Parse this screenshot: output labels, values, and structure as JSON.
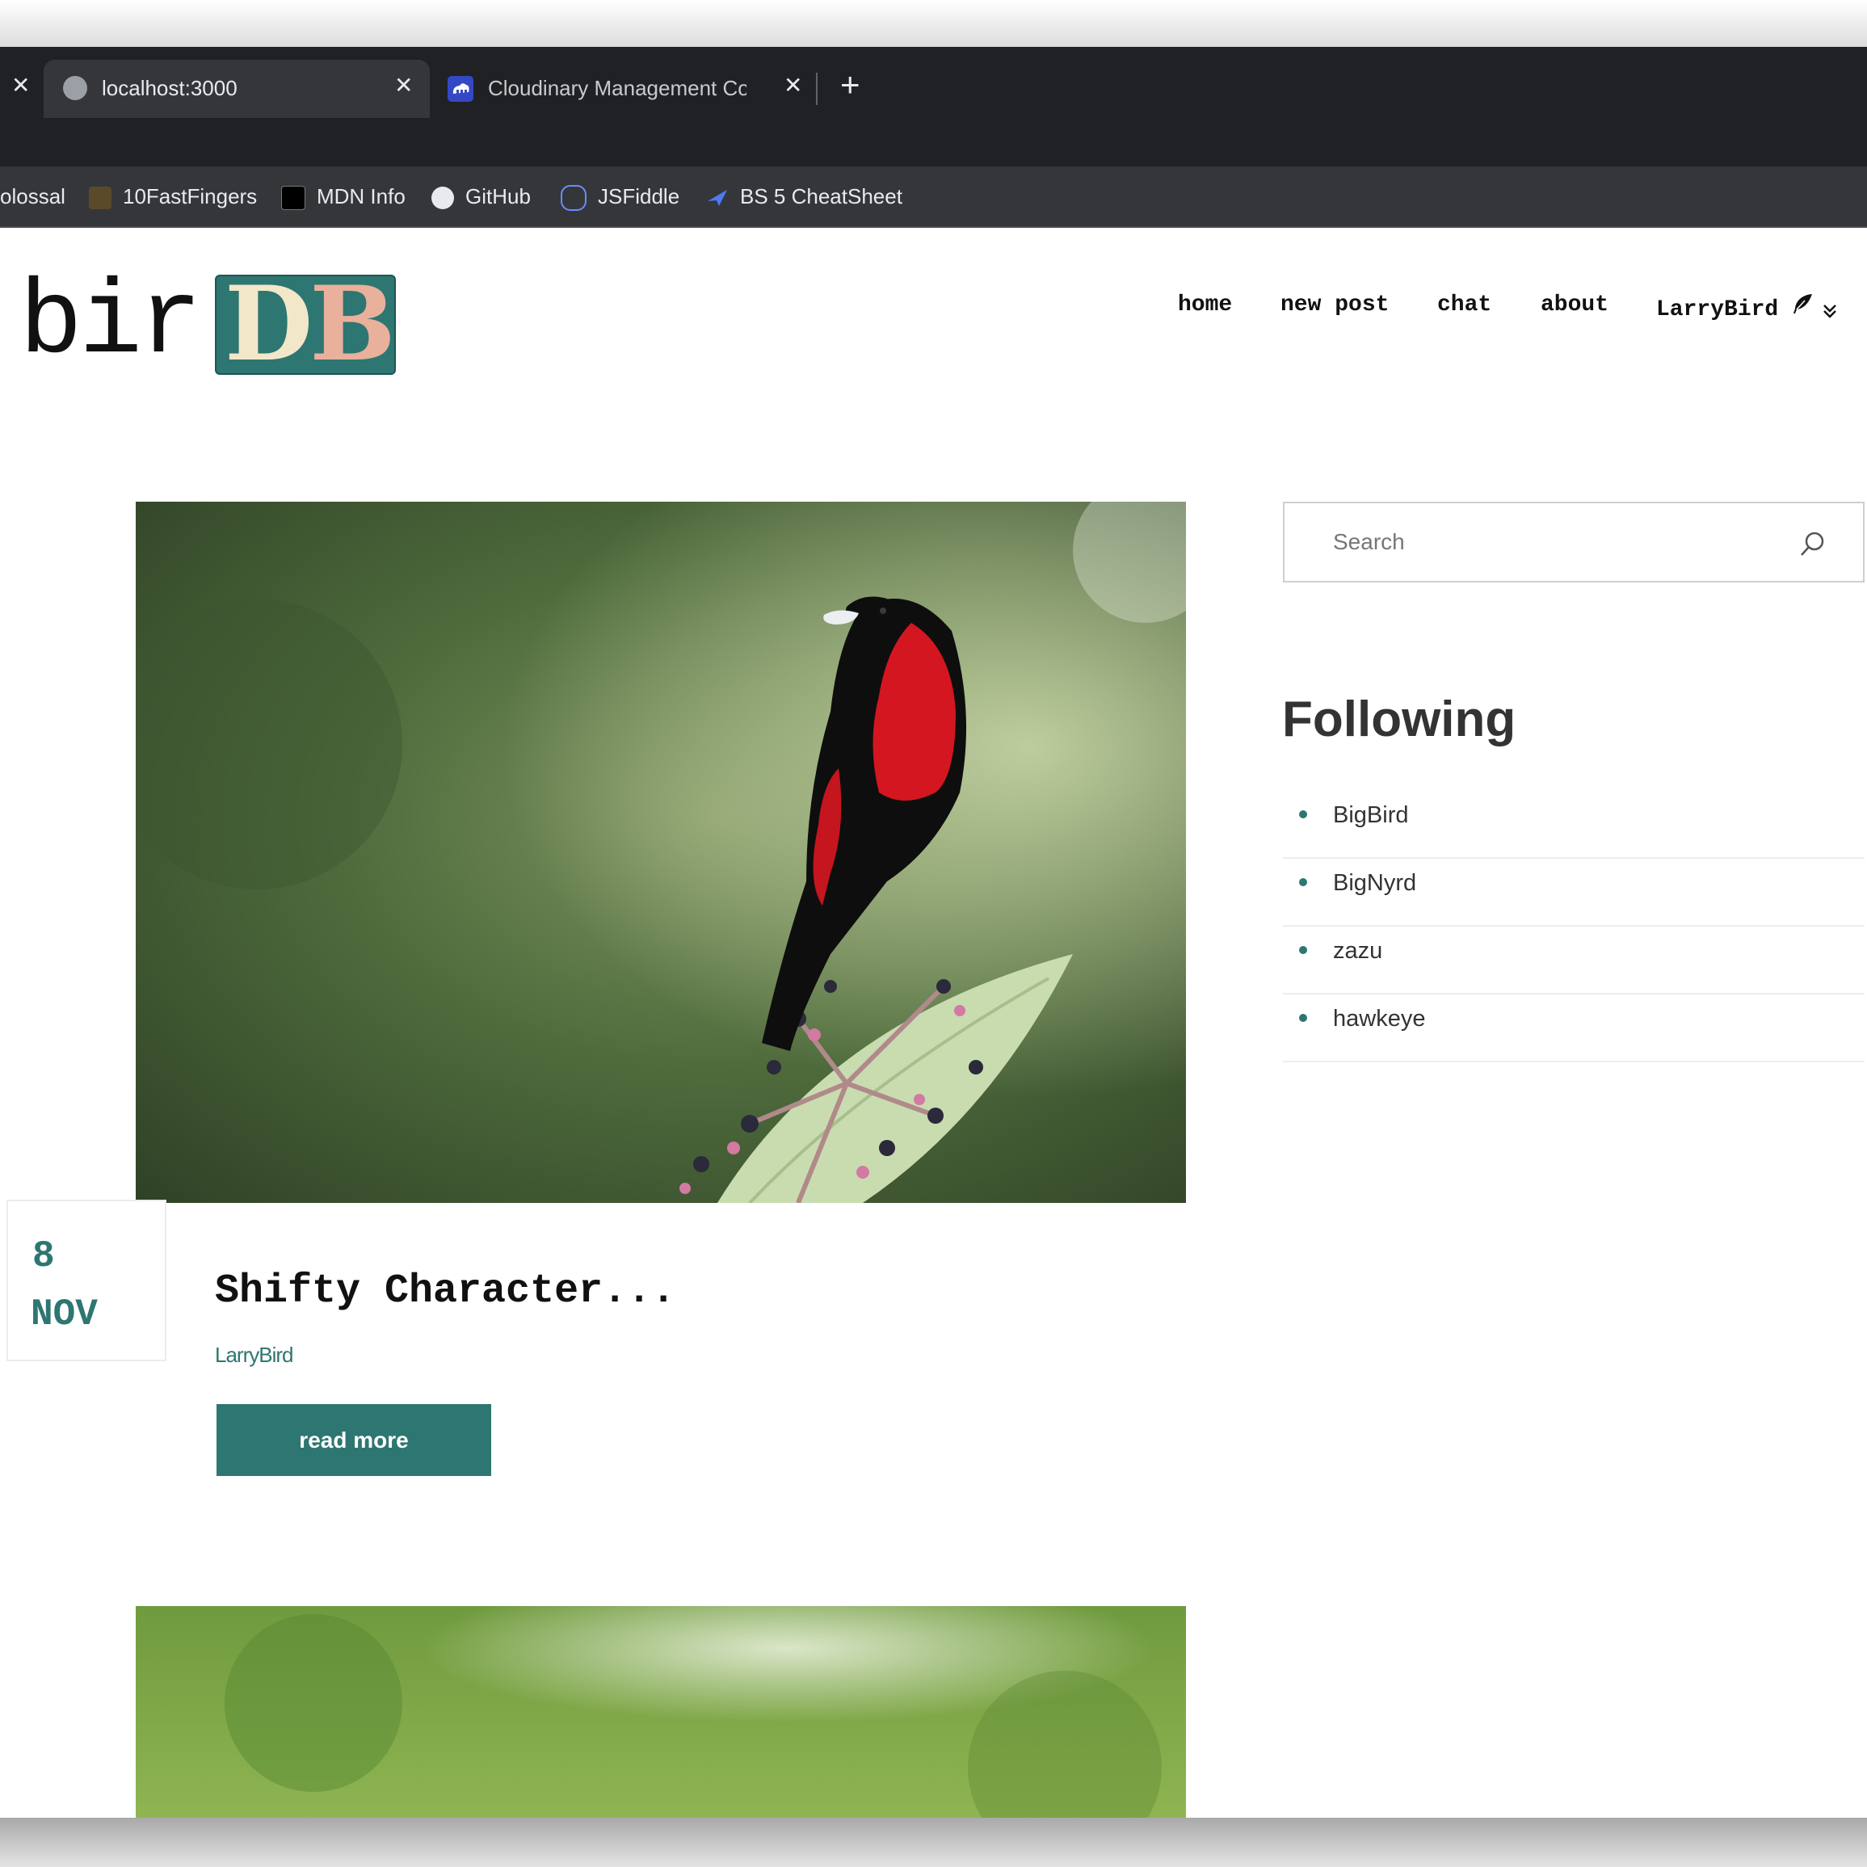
{
  "browser": {
    "tabs": [
      {
        "title": "localhost:3000",
        "active": true
      },
      {
        "title": "Cloudinary Management Console",
        "active": false
      }
    ],
    "new_tab_label": "+",
    "close_glyph": "✕",
    "bookmarks": [
      {
        "label": "olossal",
        "icon": "cut-off-icon"
      },
      {
        "label": "10FastFingers",
        "icon": "10fastfingers-icon"
      },
      {
        "label": "MDN Info",
        "icon": "mdn-icon"
      },
      {
        "label": "GitHub",
        "icon": "github-icon"
      },
      {
        "label": "JSFiddle",
        "icon": "jsfiddle-icon"
      },
      {
        "label": "BS 5 CheatSheet",
        "icon": "bootstrap-icon"
      }
    ]
  },
  "site": {
    "logo": {
      "bir": "bir",
      "d": "D",
      "b": "B"
    },
    "nav": {
      "home": "home",
      "new_post": "new post",
      "chat": "chat",
      "about": "about",
      "user": "LarryBird"
    },
    "accent_color": "#2e7671"
  },
  "post": {
    "image": "red-and-black-bird-on-berry-branch",
    "date_day": "8",
    "date_month": "NOV",
    "title": "Shifty Character...",
    "author": "LarryBird",
    "read_more": "read more"
  },
  "next_post": {
    "image": "green-blurred-background"
  },
  "sidebar": {
    "search_placeholder": "Search",
    "following_title": "Following",
    "following": [
      "BigBird",
      "BigNyrd",
      "zazu",
      "hawkeye"
    ]
  }
}
